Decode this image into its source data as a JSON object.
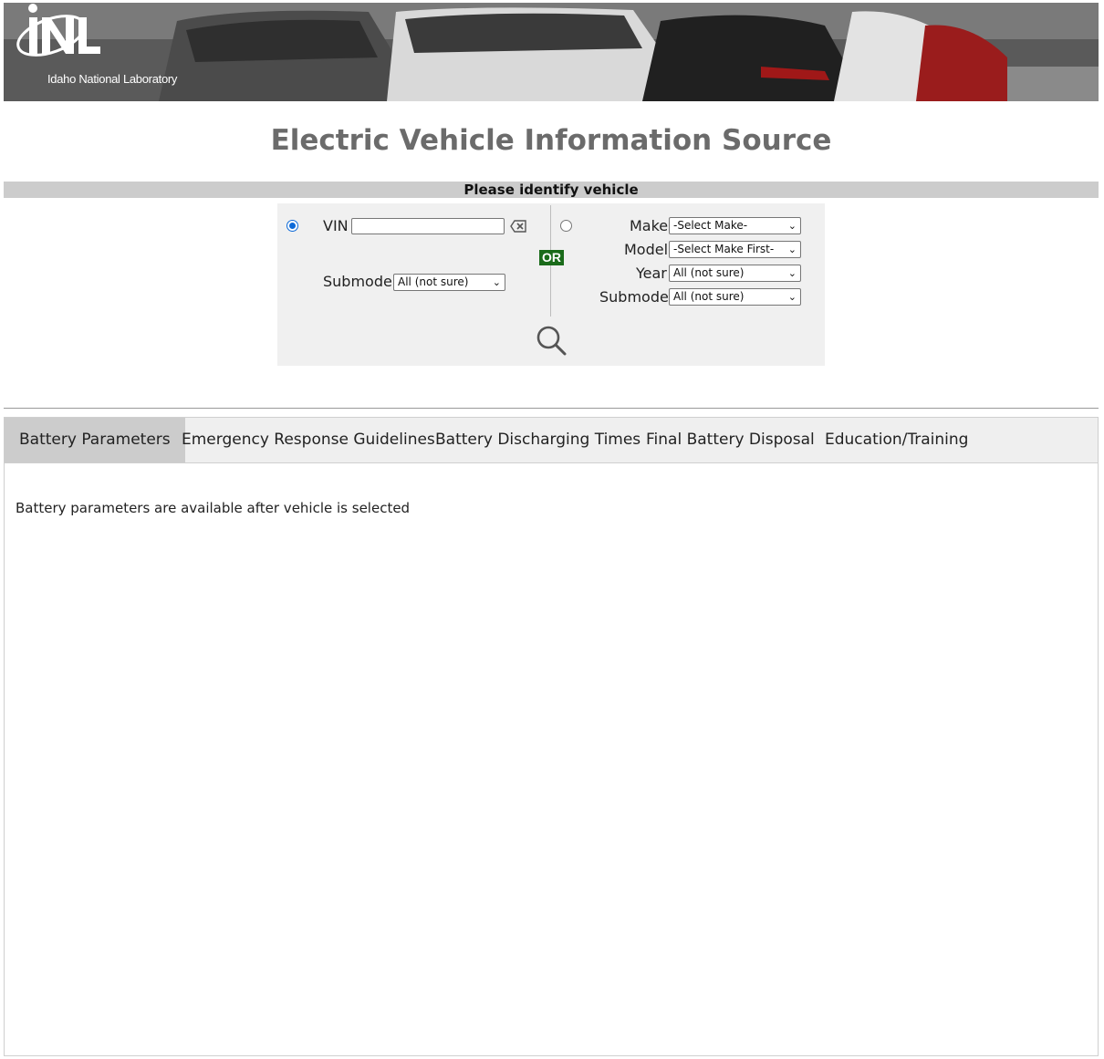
{
  "header": {
    "logo_text": "INL",
    "logo_subtitle": "Idaho National Laboratory"
  },
  "page": {
    "title": "Electric Vehicle Information Source"
  },
  "identify": {
    "heading": "Please identify vehicle",
    "or_label": "OR",
    "vin": {
      "label": "VIN",
      "value": "",
      "selected": true,
      "submodel_label": "Submodel",
      "submodel_value": "All (not sure)"
    },
    "by_make": {
      "selected": false,
      "make_label": "Make",
      "make_value": "-Select Make-",
      "model_label": "Model",
      "model_value": "-Select Make First-",
      "year_label": "Year",
      "year_value": "All (not sure)",
      "submodel_label": "Submodel",
      "submodel_value": "All (not sure)"
    }
  },
  "tabs": [
    {
      "label": "Battery Parameters",
      "active": true
    },
    {
      "label": "Emergency Response Guidelines",
      "active": false
    },
    {
      "label": "Battery Discharging Times",
      "active": false
    },
    {
      "label": "Final Battery Disposal",
      "active": false
    },
    {
      "label": "Education/Training",
      "active": false
    }
  ],
  "panel": {
    "message": "Battery parameters are available after vehicle is selected"
  },
  "colors": {
    "or_badge": "#1a6b1a",
    "radio_accent": "#0d6ad8",
    "title_gray": "#6b6b6b"
  }
}
